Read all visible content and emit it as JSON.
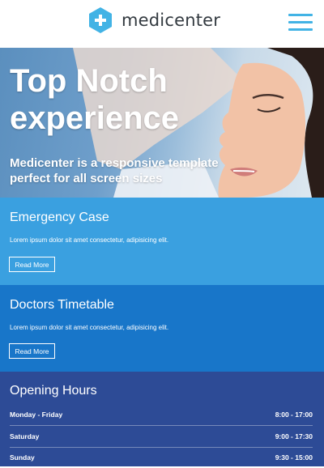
{
  "header": {
    "logo_text": "medicenter",
    "logo_icon": "hexagon-plus-icon",
    "menu_icon": "hamburger-menu-icon",
    "colors": {
      "accent": "#42b3e5",
      "logo_text": "#333a40"
    }
  },
  "hero": {
    "title": "Top Notch experience",
    "subtitle": "Medicenter is a responsive template perfect for all screen sizes"
  },
  "emergency": {
    "title": "Emergency Case",
    "text": "Lorem ipsum dolor sit amet consectetur, adipisicing elit.",
    "button_label": "Read More",
    "color": "#3aa0e0"
  },
  "doctors": {
    "title": "Doctors Timetable",
    "text": "Lorem ipsum dolor sit amet consectetur, adipisicing elit.",
    "button_label": "Read More",
    "color": "#1876c9"
  },
  "hours": {
    "title": "Opening Hours",
    "color": "#2d4b96",
    "rows": [
      {
        "day": "Monday - Friday",
        "time": "8:00 - 17:00"
      },
      {
        "day": "Saturday",
        "time": "9:00 - 17:30"
      },
      {
        "day": "Sunday",
        "time": "9:30 - 15:00"
      }
    ]
  }
}
